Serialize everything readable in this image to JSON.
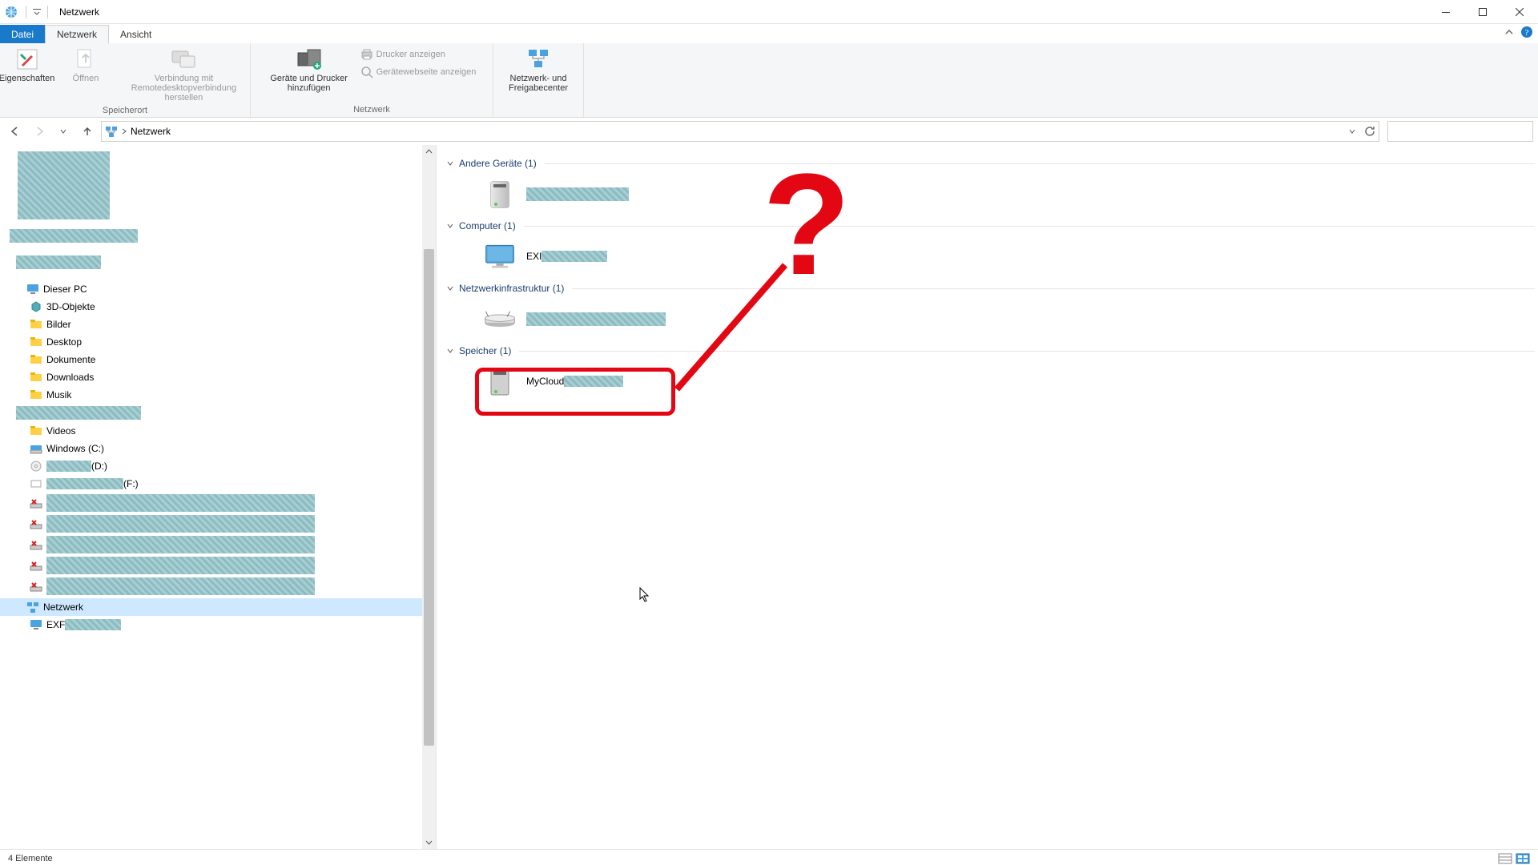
{
  "window": {
    "title": "Netzwerk"
  },
  "tabs": {
    "file": "Datei",
    "network": "Netzwerk",
    "view": "Ansicht"
  },
  "ribbon": {
    "group_location": "Speicherort",
    "group_network": "Netzwerk",
    "properties": "Eigenschaften",
    "open": "Öffnen",
    "rdp": "Verbindung mit\nRemotedesktopverbindung herstellen",
    "add_devices": "Geräte und Drucker\nhinzufügen",
    "show_printers": "Drucker anzeigen",
    "show_device_web": "Gerätewebseite anzeigen",
    "network_center": "Netzwerk- und\nFreigabecenter"
  },
  "address": {
    "location": "Netzwerk"
  },
  "nav": {
    "this_pc": "Dieser PC",
    "objects3d": "3D-Objekte",
    "pictures": "Bilder",
    "desktop": "Desktop",
    "documents": "Dokumente",
    "downloads": "Downloads",
    "music": "Musik",
    "videos": "Videos",
    "windows_c": "Windows (C:)",
    "drive_d_suffix": "(D:)",
    "drive_f_suffix": "(F:)",
    "network": "Netzwerk",
    "net_exf_prefix": "EXF"
  },
  "groups": {
    "other": {
      "label": "Andere Geräte (1)"
    },
    "computer": {
      "label": "Computer (1)",
      "item_prefix": "EXI"
    },
    "infra": {
      "label": "Netzwerkinfrastruktur (1)"
    },
    "storage": {
      "label": "Speicher (1)",
      "item_prefix": "MyCloud"
    }
  },
  "status": {
    "text": "4 Elemente"
  }
}
